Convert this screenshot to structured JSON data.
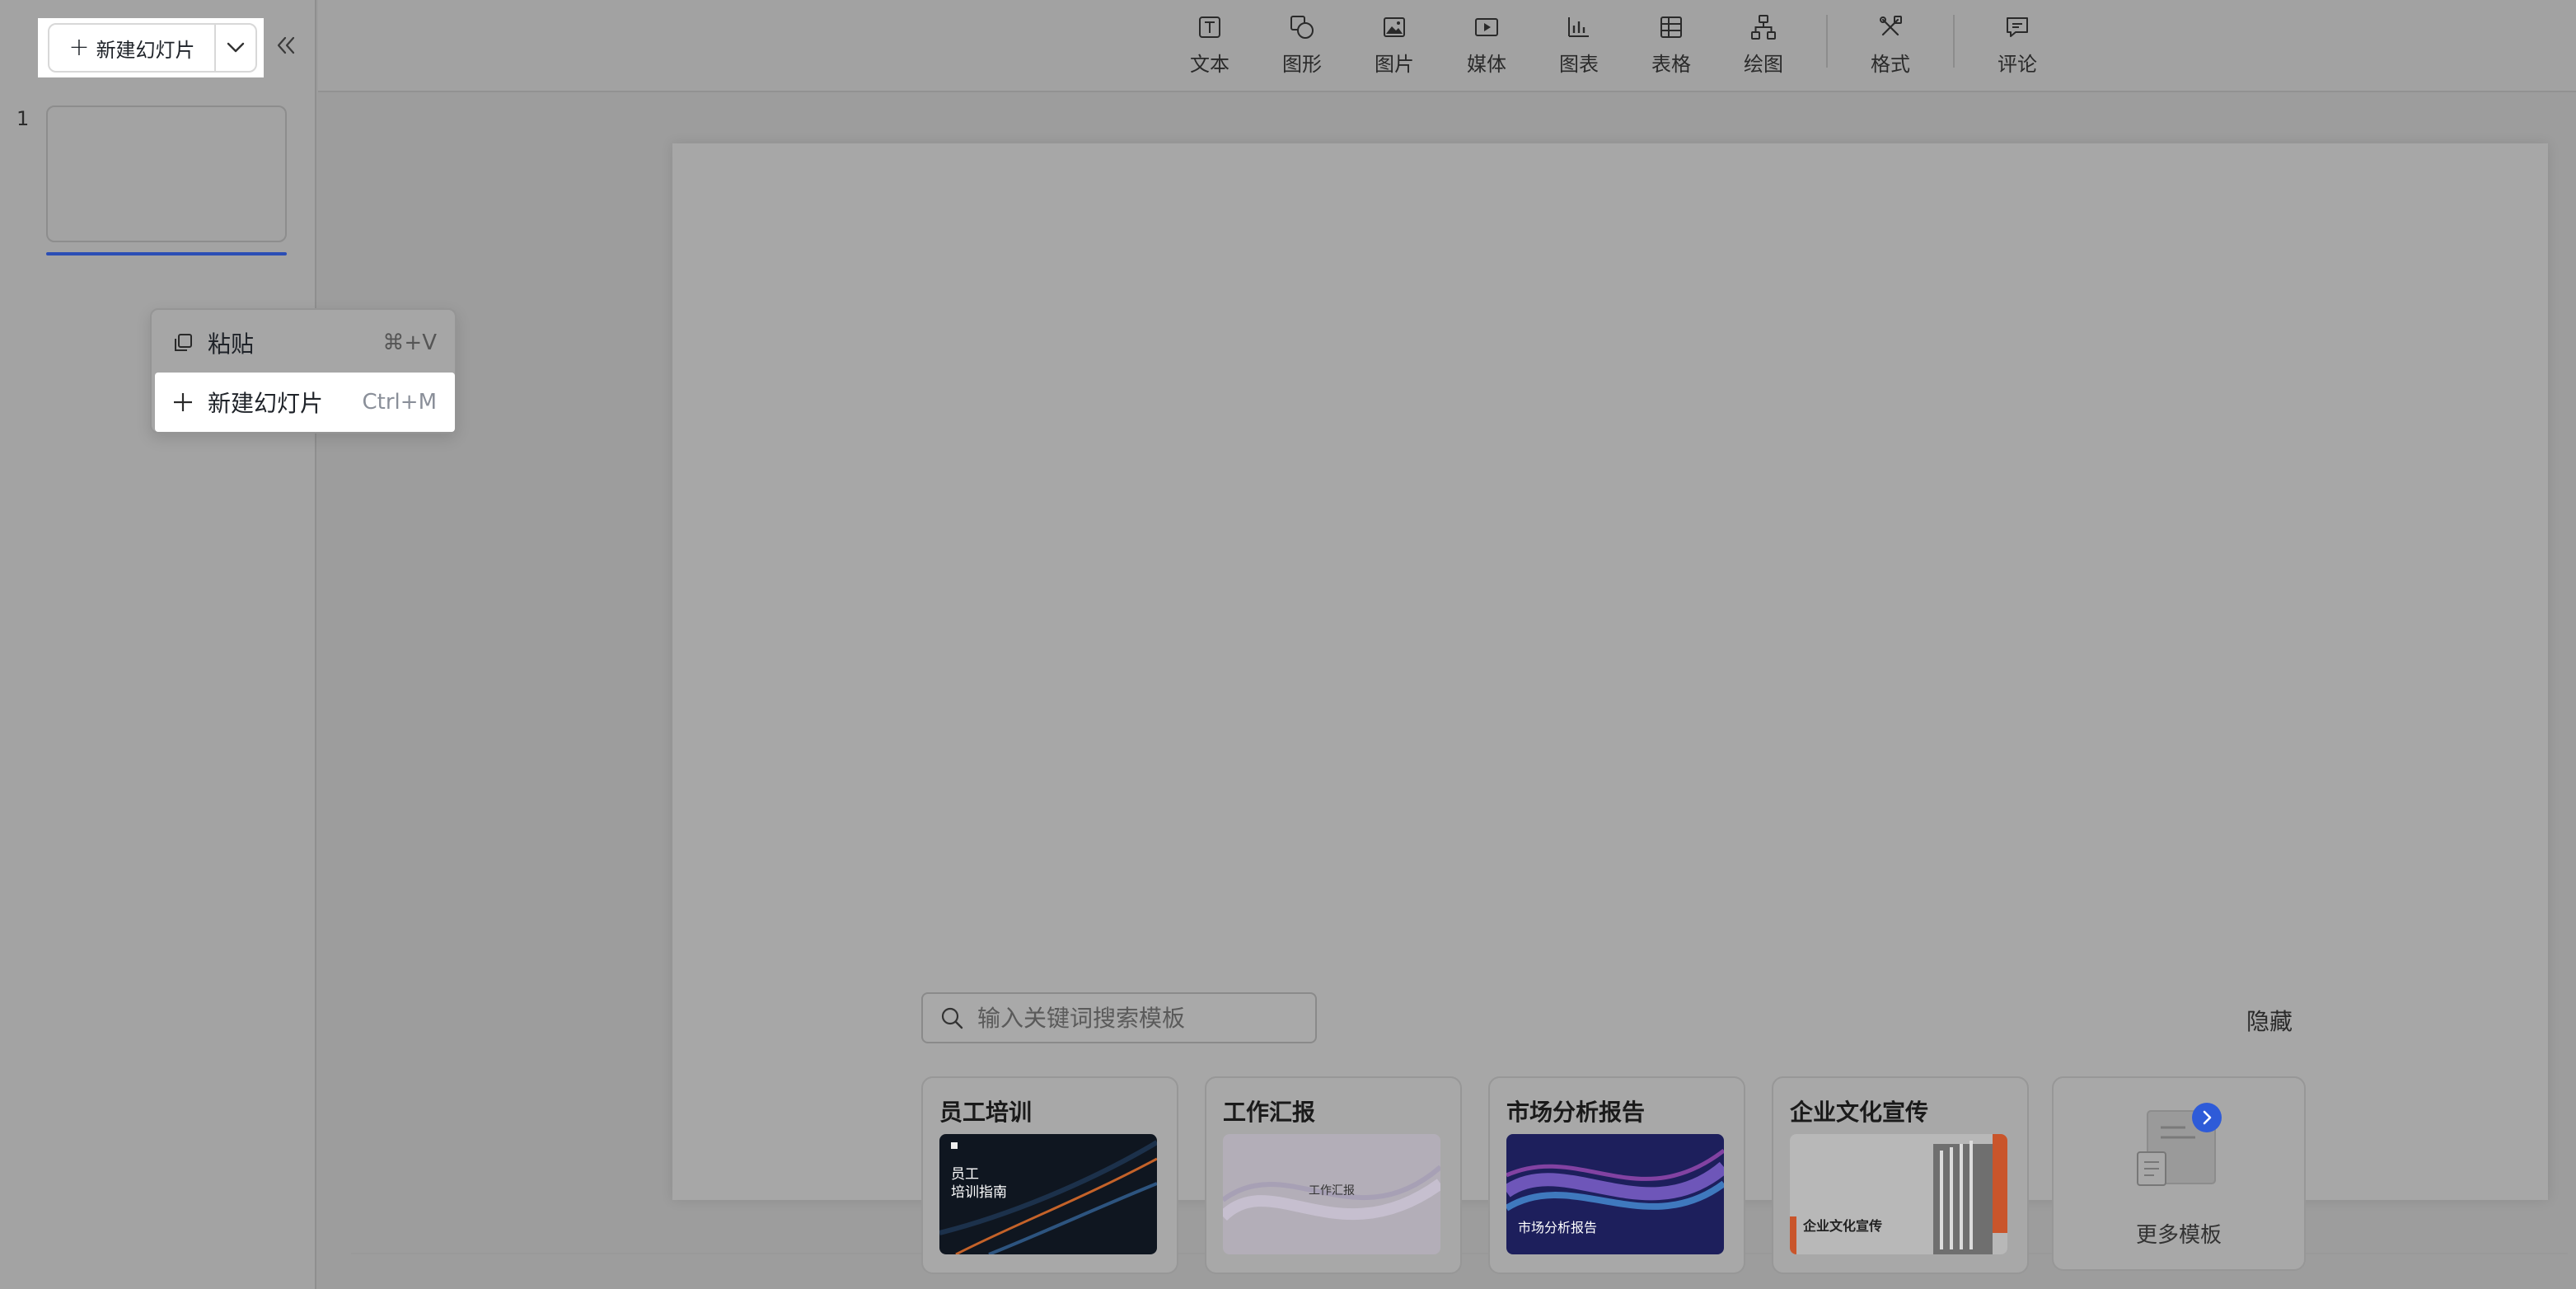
{
  "sidebar": {
    "new_slide_label": "新建幻灯片",
    "slide_number": "1"
  },
  "context_menu": {
    "items": [
      {
        "label": "粘贴",
        "shortcut": "⌘+V",
        "icon": "copy-icon"
      },
      {
        "label": "新建幻灯片",
        "shortcut": "Ctrl+M",
        "icon": "plus-icon"
      }
    ]
  },
  "toolbar": {
    "tools": [
      {
        "label": "文本",
        "icon": "text-box-icon"
      },
      {
        "label": "图形",
        "icon": "shapes-icon"
      },
      {
        "label": "图片",
        "icon": "image-icon"
      },
      {
        "label": "媒体",
        "icon": "media-icon"
      },
      {
        "label": "图表",
        "icon": "chart-icon"
      },
      {
        "label": "表格",
        "icon": "table-icon"
      },
      {
        "label": "绘图",
        "icon": "diagram-icon"
      },
      {
        "label": "格式",
        "icon": "format-icon"
      },
      {
        "label": "评论",
        "icon": "comment-icon"
      }
    ]
  },
  "templates": {
    "search_placeholder": "输入关键词搜索模板",
    "hide_label": "隐藏",
    "cards": [
      {
        "title": "员工培训",
        "thumb_title_line1": "员工",
        "thumb_title_line2": "培训指南"
      },
      {
        "title": "工作汇报",
        "thumb_title": "工作汇报"
      },
      {
        "title": "市场分析报告",
        "thumb_title": "市场分析报告"
      },
      {
        "title": "企业文化宣传",
        "thumb_title": "企业文化宣传"
      }
    ],
    "more_label": "更多模板"
  },
  "colors": {
    "accent": "#2b4eb5",
    "more_badge": "#2e5bd8"
  }
}
